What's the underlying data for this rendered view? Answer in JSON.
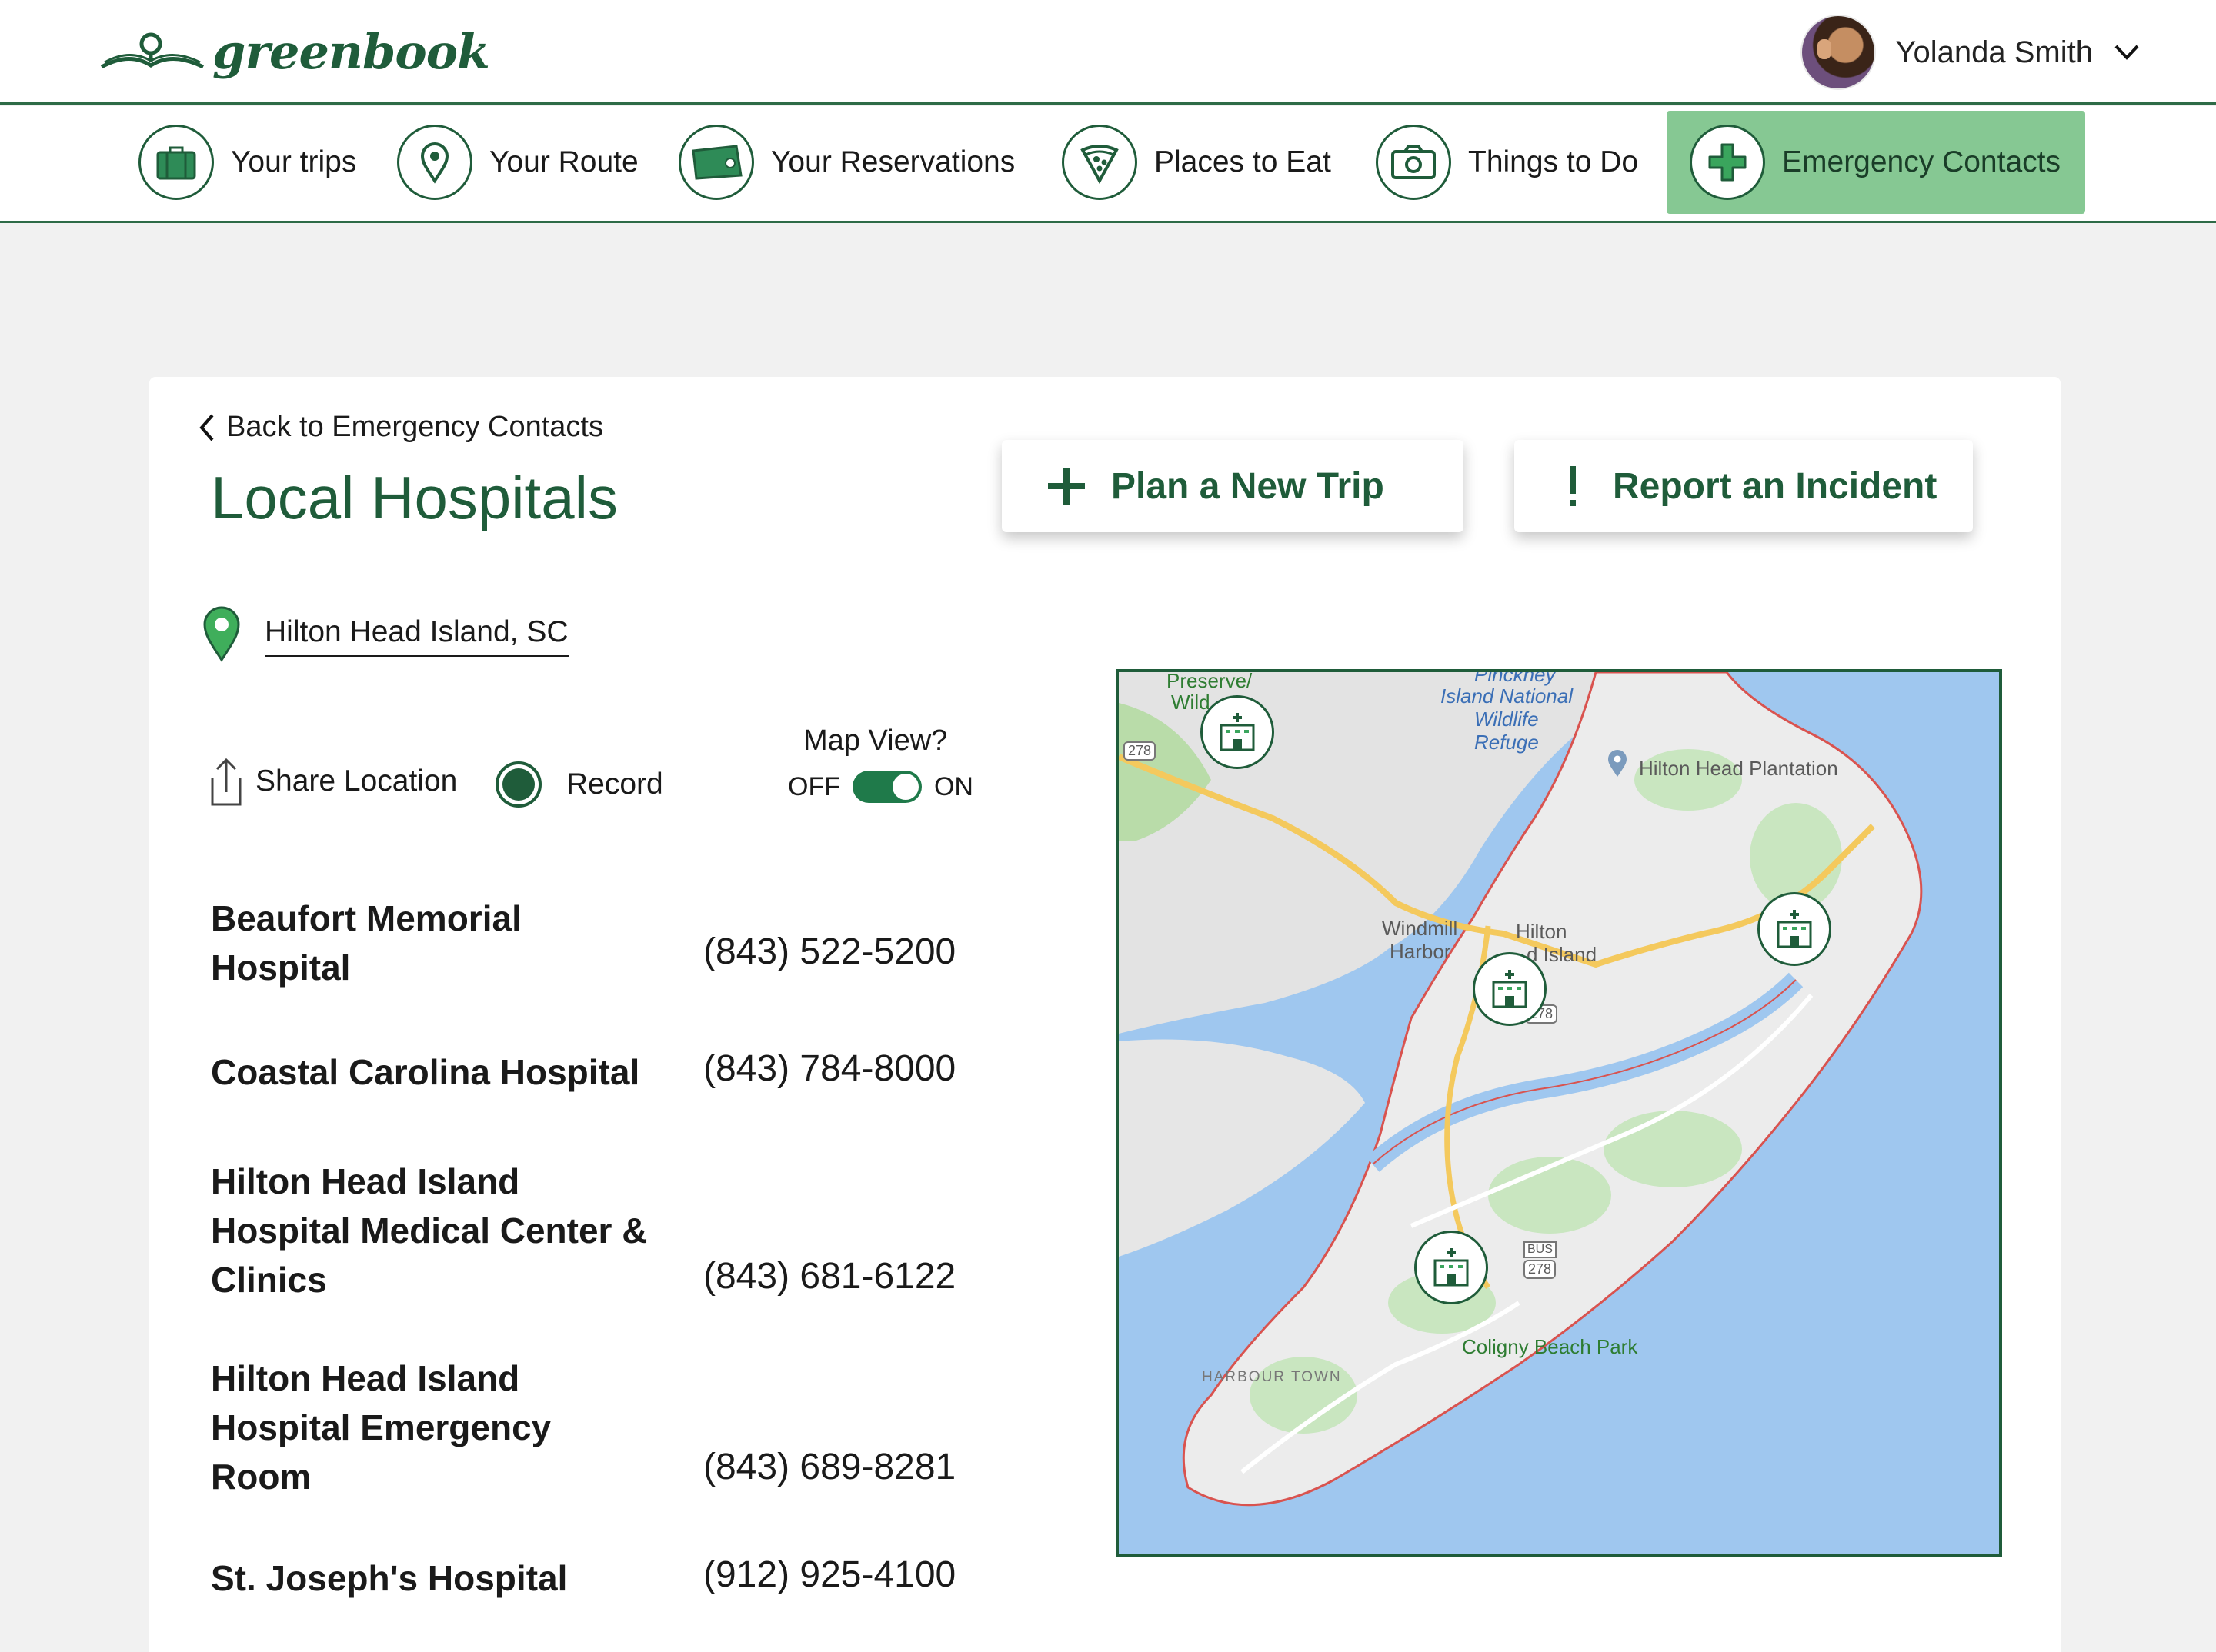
{
  "header": {
    "brand": "greenbook",
    "user_name": "Yolanda Smith"
  },
  "nav": [
    {
      "label": "Your trips",
      "icon": "suitcase-icon"
    },
    {
      "label": "Your Route",
      "icon": "map-pin-icon"
    },
    {
      "label": "Your Reservations",
      "icon": "ticket-icon"
    },
    {
      "label": "Places to Eat",
      "icon": "pizza-icon"
    },
    {
      "label": "Things to Do",
      "icon": "camera-icon"
    },
    {
      "label": "Emergency Contacts",
      "icon": "medical-cross-icon",
      "active": true
    }
  ],
  "page": {
    "back_label": "Back to Emergency Contacts",
    "title": "Local Hospitals",
    "plan_trip_label": "Plan a New Trip",
    "report_incident_label": "Report an Incident",
    "location": "Hilton Head Island, SC",
    "share_label": "Share Location",
    "record_label": "Record",
    "map_view_label": "Map View?",
    "toggle_off": "OFF",
    "toggle_on": "ON",
    "toggle_state": "on"
  },
  "hospitals": [
    {
      "name": "Beaufort Memorial Hospital",
      "phone": "(843) 522-5200"
    },
    {
      "name": "Coastal Carolina Hospital",
      "phone": "(843) 784-8000"
    },
    {
      "name": "Hilton Head Island Hospital Medical Center & Clinics",
      "phone": "(843) 681-6122"
    },
    {
      "name": "Hilton Head Island Hospital Emergency Room",
      "phone": "(843) 689-8281"
    },
    {
      "name": "St. Joseph's Hospital",
      "phone": "(912) 925-4100"
    }
  ],
  "map": {
    "labels": {
      "preserve": "Preserve/",
      "wild": "Wild",
      "pinckney": "Pinckney",
      "refuge_1": "Island National",
      "refuge_2": "Wildlife",
      "refuge_3": "Refuge",
      "plantation": "Hilton Head Plantation",
      "windmill_1": "Windmill",
      "windmill_2": "Harbor",
      "hilton_1": "Hilton",
      "hilton_2": "d Island",
      "coligny": "Coligny Beach Park",
      "harbour": "HARBOUR TOWN",
      "route_1": "278",
      "route_2": "278",
      "route_3": "278",
      "bus": "BUS"
    },
    "colors": {
      "water": "#9fc7ef",
      "land": "#ececec",
      "outline": "#d9534f",
      "road": "#f4c95d",
      "park": "#c9e6c0"
    }
  },
  "colors": {
    "brand": "#1f5c3a",
    "active_nav": "#86c893",
    "background": "#f1f1f1"
  }
}
